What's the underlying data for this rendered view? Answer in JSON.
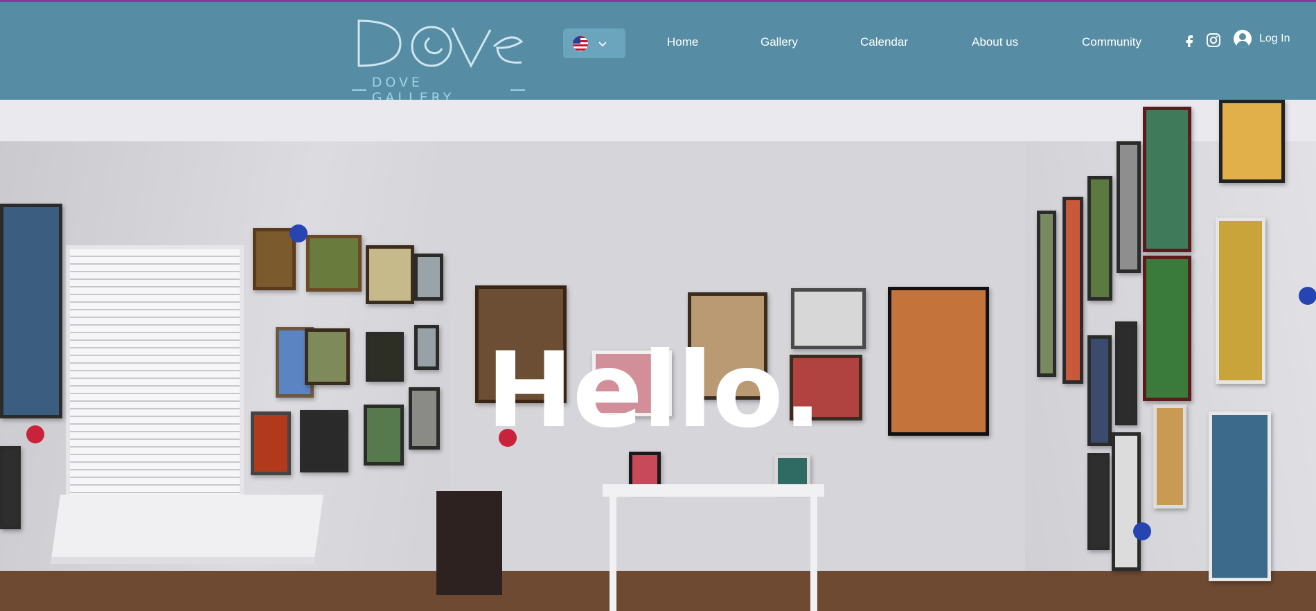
{
  "header": {
    "logo_main": "Dove",
    "logo_sub": "DOVE GALLERY",
    "nav": [
      {
        "label": "Home"
      },
      {
        "label": "Gallery"
      },
      {
        "label": "Calendar"
      },
      {
        "label": "About us"
      },
      {
        "label": "Community"
      }
    ],
    "login_label": "Log In"
  },
  "hero": {
    "title": "Hello."
  },
  "colors": {
    "header_bg": "#568da4",
    "top_border": "#8a3a95",
    "logo_sub": "#9fd5e8",
    "language_button_bg": "#6aa5bd"
  },
  "icons": {
    "language": "us-flag-icon",
    "dropdown": "chevron-down-icon",
    "facebook": "facebook-icon",
    "instagram": "instagram-icon",
    "account": "user-avatar-icon"
  }
}
